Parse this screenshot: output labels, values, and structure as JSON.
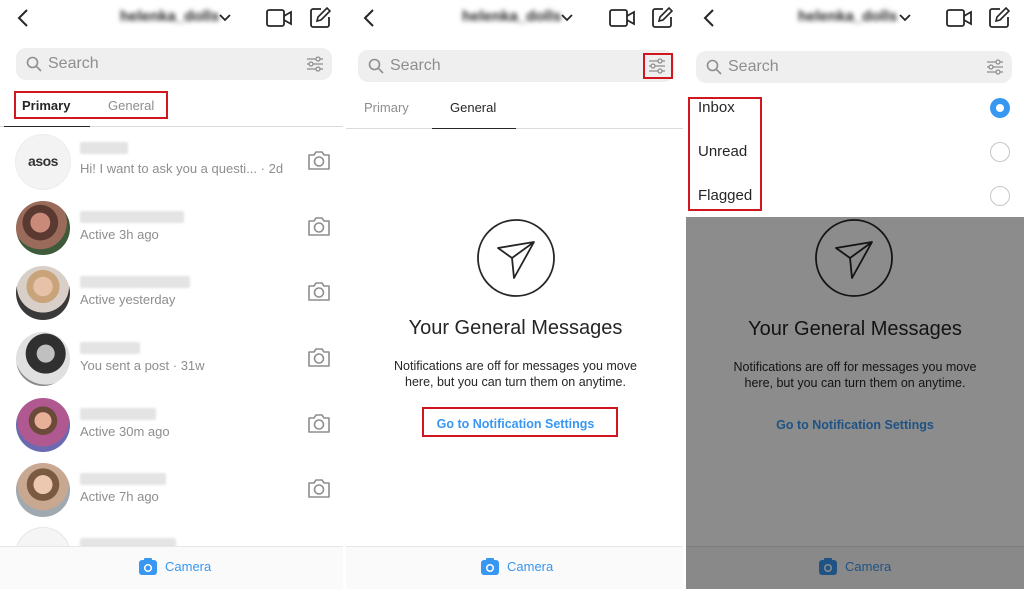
{
  "header": {
    "username": "helenka_dolls",
    "back_icon": "chevron-left-icon",
    "dropdown_icon": "chevron-down-icon",
    "video_icon": "video-camera-icon",
    "compose_icon": "compose-icon"
  },
  "search": {
    "placeholder": "Search",
    "filter_icon": "sliders-icon"
  },
  "tabs": {
    "primary": "Primary",
    "general": "General"
  },
  "panel1": {
    "active_tab": "Primary",
    "threads": [
      {
        "name": "asos_",
        "avatar_text": "asos",
        "preview": "Hi! I want to ask you a questi...",
        "time": "· 2d"
      },
      {
        "name": "",
        "preview": "Active 3h ago"
      },
      {
        "name": "",
        "preview": "Active yesterday"
      },
      {
        "name": "",
        "preview": "You sent a post · 31w"
      },
      {
        "name": "",
        "preview": "Active 30m ago"
      },
      {
        "name": "",
        "preview": "Active 7h ago"
      }
    ]
  },
  "panel2": {
    "active_tab": "General",
    "empty_title": "Your General Messages",
    "empty_desc_line1": "Notifications are off for messages you move",
    "empty_desc_line2": "here, but you can turn them on anytime.",
    "settings_link": "Go to Notification Settings"
  },
  "panel3": {
    "filter_options": [
      {
        "label": "Inbox",
        "selected": true
      },
      {
        "label": "Unread",
        "selected": false
      },
      {
        "label": "Flagged",
        "selected": false
      }
    ],
    "empty_title": "Your General Messages",
    "empty_desc_line1": "Notifications are off for messages you move",
    "empty_desc_line2": "here, but you can turn them on anytime.",
    "settings_link": "Go to Notification Settings"
  },
  "bottom": {
    "camera_label": "Camera",
    "camera_icon": "camera-icon"
  },
  "colors": {
    "accent": "#3897f0",
    "highlight": "#d0161e",
    "search_bg": "#efefef",
    "muted_text": "#8e8e8e"
  }
}
